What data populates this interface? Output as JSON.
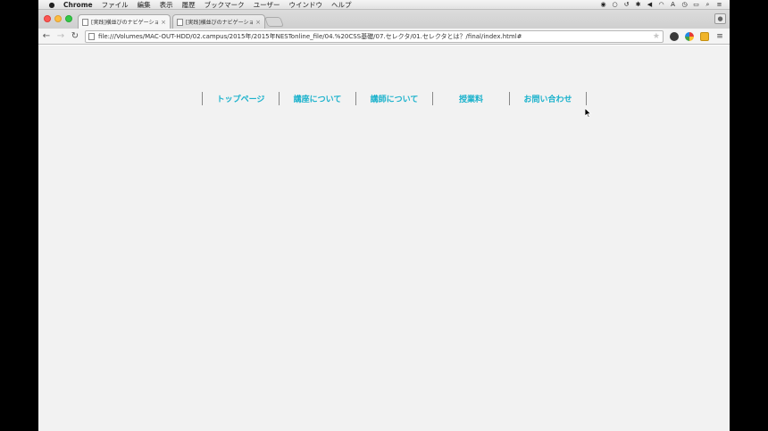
{
  "menubar": {
    "app_name": "Chrome",
    "items": [
      "ファイル",
      "編集",
      "表示",
      "履歴",
      "ブックマーク",
      "ユーザー",
      "ウインドウ",
      "ヘルプ"
    ]
  },
  "tabs": [
    {
      "title": "[実践]横並びのナビゲーショ",
      "active": true
    },
    {
      "title": "[実践]横並びのナビゲーショ",
      "active": false
    }
  ],
  "address_bar": {
    "url": "file:///Volumes/MAC-OUT-HDD/02.campus/2015年/2015年NESTonline_file/04.%20CSS基礎/07.セレクタ/01.セレクタとは？/final/index.html#"
  },
  "page": {
    "nav_items": [
      "トップページ",
      "講座について",
      "講師について",
      "授業料",
      "お問い合わせ"
    ]
  },
  "colors": {
    "nav_text": "#1bb2cc",
    "page_background": "#f2f2f2"
  }
}
